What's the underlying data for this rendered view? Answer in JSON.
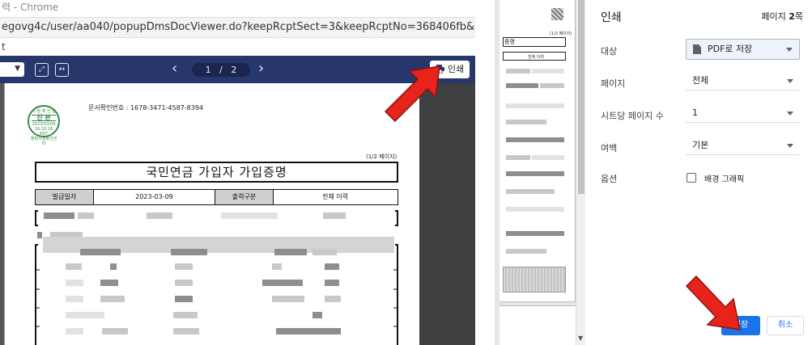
{
  "browser": {
    "window_title": "력 - Chrome",
    "url": "egovg4c/user/aa040/popupDmsDocViewer.do?keepRcptSect=3&keepRcptNo=368406fb&printAuth=",
    "strip_text": "t"
  },
  "viewer": {
    "page_current": "1",
    "page_separator": "/",
    "page_total": "2",
    "print_label": "인쇄"
  },
  "document": {
    "doc_number": "문서확인번호 : 1678-3471-4587-8394",
    "page_count": "(1/2 페이지)",
    "title": "국민연금 가입자 가입증명",
    "seal": {
      "top": "시 청 확 인 필",
      "middle": "진 본",
      "line1": "2023/03/09",
      "line2": "16:32:18",
      "line3": "KST",
      "bottom": "행정시청확인센터"
    },
    "info": {
      "issue_label": "발급일자",
      "issue_date": "2023-03-09",
      "output_label": "출력구분",
      "output_value": "전체 이력"
    }
  },
  "preview": {
    "title_fragment": "증명",
    "page_fragment": "(1/2 페이지)",
    "box_text": "전체 이력"
  },
  "print_dialog": {
    "title": "인쇄",
    "page_count_prefix": "페이지 ",
    "page_count_num": "2",
    "page_count_suffix": "쪽",
    "destination_label": "대상",
    "destination_value": "PDF로 저장",
    "pages_label": "페이지",
    "pages_value": "전체",
    "per_sheet_label": "시트당 페이지 수",
    "per_sheet_value": "1",
    "margins_label": "여백",
    "margins_value": "기본",
    "options_label": "옵션",
    "background_label": "배경 그래픽",
    "save_label": "저장",
    "cancel_label": "취소"
  },
  "colors": {
    "viewer_toolbar": "#27366b",
    "primary_button": "#1a73e8",
    "arrow_red": "#e8231b",
    "seal_green": "#3a8a47"
  }
}
